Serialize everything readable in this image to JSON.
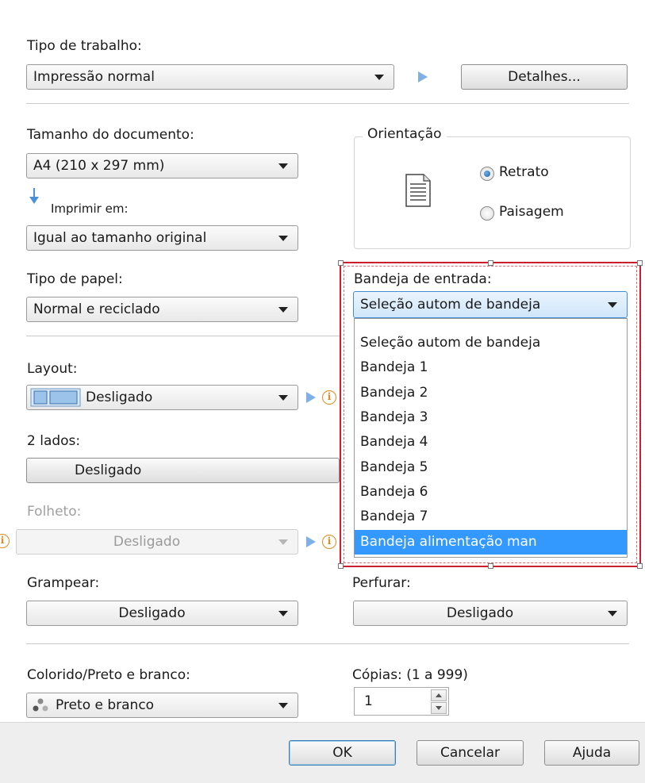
{
  "job_type": {
    "label": "Tipo de trabalho:",
    "value": "Impressão normal",
    "details_button": "Detalhes..."
  },
  "document_size": {
    "label": "Tamanho do documento:",
    "value": "A4 (210 x 297 mm)"
  },
  "print_on": {
    "label": "Imprimir em:",
    "value": "Igual ao tamanho original"
  },
  "orientation": {
    "title": "Orientação",
    "portrait": "Retrato",
    "landscape": "Paisagem",
    "selected": "Retrato"
  },
  "paper_type": {
    "label": "Tipo de papel:",
    "value": "Normal e reciclado"
  },
  "input_tray": {
    "label": "Bandeja de entrada:",
    "value": "Seleção autom de bandeja",
    "options": [
      "Seleção autom de bandeja",
      "Bandeja 1",
      "Bandeja 2",
      "Bandeja 3",
      "Bandeja 4",
      "Bandeja 5",
      "Bandeja 6",
      "Bandeja 7",
      "Bandeja alimentação man"
    ],
    "highlighted": "Bandeja alimentação man"
  },
  "layout": {
    "label": "Layout:",
    "value": "Desligado"
  },
  "two_sided": {
    "label": "2 lados:",
    "value": "Desligado"
  },
  "booklet": {
    "label": "Folheto:",
    "value": "Desligado"
  },
  "staple": {
    "label": "Grampear:",
    "value": "Desligado"
  },
  "punch": {
    "label": "Perfurar:",
    "value": "Desligado"
  },
  "color": {
    "label": "Colorido/Preto e branco:",
    "value": "Preto e branco"
  },
  "copies": {
    "label": "Cópias: (1 a 999)",
    "value": "1"
  },
  "footer": {
    "ok": "OK",
    "cancel": "Cancelar",
    "help": "Ajuda"
  },
  "colors": {
    "highlight": "#3399ff",
    "selection_frame": "#cc1f2d",
    "play_arrow": "#7fb0e6",
    "info_icon": "#e08a1e"
  }
}
